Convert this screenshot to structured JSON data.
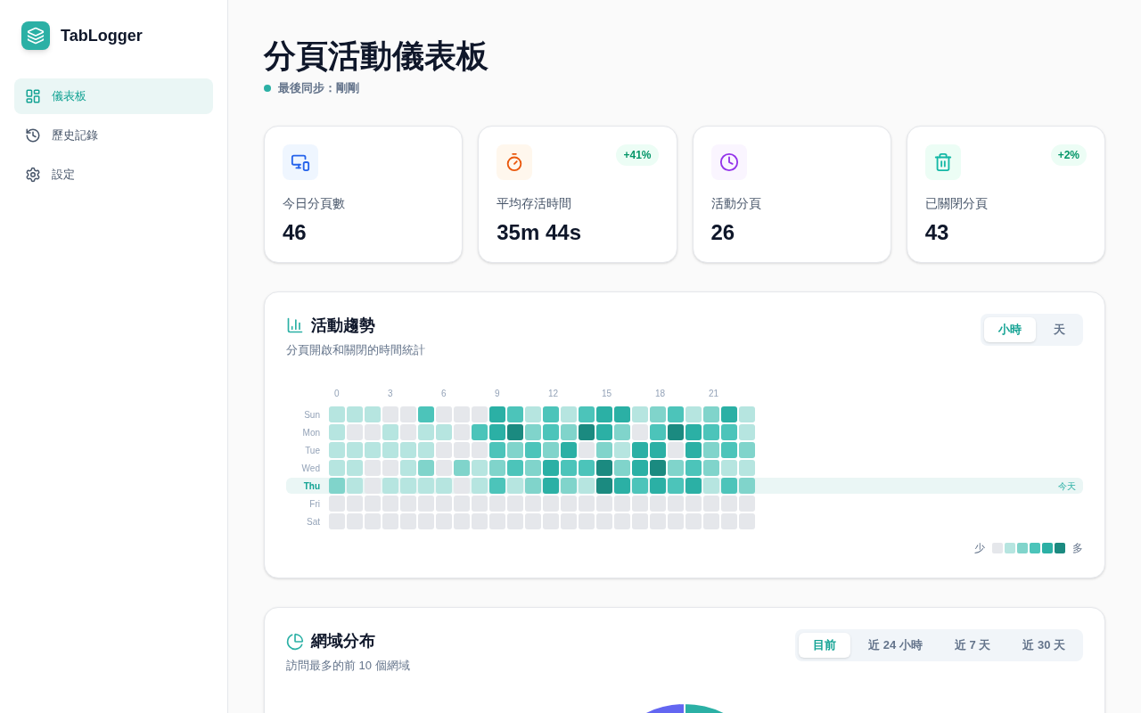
{
  "app": {
    "name": "TabLogger"
  },
  "sidebar": {
    "items": [
      {
        "kind": "dashboard",
        "label": "儀表板",
        "selected": true
      },
      {
        "kind": "history",
        "label": "歷史記錄",
        "selected": false
      },
      {
        "kind": "settings",
        "label": "設定",
        "selected": false
      }
    ]
  },
  "header": {
    "title": "分頁活動儀表板",
    "sync_label": "最後同步：",
    "sync_value": "剛剛"
  },
  "stats": [
    {
      "kind": "tabs",
      "label": "今日分頁數",
      "value": "46"
    },
    {
      "kind": "lifetime",
      "label": "平均存活時間",
      "value": "35m 44s",
      "badge": "+41%"
    },
    {
      "kind": "active",
      "label": "活動分頁",
      "value": "26"
    },
    {
      "kind": "closed",
      "label": "已關閉分頁",
      "value": "43",
      "badge": "+2%"
    }
  ],
  "activity": {
    "title": "活動趨勢",
    "subtitle": "分頁開啟和關閉的時間統計",
    "toggle": [
      {
        "label": "小時",
        "selected": true
      },
      {
        "label": "天",
        "selected": false
      }
    ],
    "hours": [
      {
        "label": "0"
      },
      {
        "label": "3"
      },
      {
        "label": "6"
      },
      {
        "label": "9"
      },
      {
        "label": "12"
      },
      {
        "label": "15"
      },
      {
        "label": "18"
      },
      {
        "label": "21"
      }
    ],
    "rows": [
      {
        "day": "Sun",
        "today": false,
        "cells": [
          {
            "color": "#b6e5e0"
          },
          {
            "color": "#b6e5e0"
          },
          {
            "color": "#b6e5e0"
          },
          {
            "color": "#e5e7eb"
          },
          {
            "color": "#e5e7eb"
          },
          {
            "color": "#4cc4ba"
          },
          {
            "color": "#e5e7eb"
          },
          {
            "color": "#e5e7eb"
          },
          {
            "color": "#e5e7eb"
          },
          {
            "color": "#2bb0a5"
          },
          {
            "color": "#4cc4ba"
          },
          {
            "color": "#b6e5e0"
          },
          {
            "color": "#4cc4ba"
          },
          {
            "color": "#b6e5e0"
          },
          {
            "color": "#4cc4ba"
          },
          {
            "color": "#2bb0a5"
          },
          {
            "color": "#2bb0a5"
          },
          {
            "color": "#b6e5e0"
          },
          {
            "color": "#80d4cb"
          },
          {
            "color": "#4cc4ba"
          },
          {
            "color": "#b6e5e0"
          },
          {
            "color": "#80d4cb"
          },
          {
            "color": "#2bb0a5"
          },
          {
            "color": "#b6e5e0"
          }
        ]
      },
      {
        "day": "Mon",
        "today": false,
        "cells": [
          {
            "color": "#b6e5e0"
          },
          {
            "color": "#e5e7eb"
          },
          {
            "color": "#e5e7eb"
          },
          {
            "color": "#b6e5e0"
          },
          {
            "color": "#e5e7eb"
          },
          {
            "color": "#b6e5e0"
          },
          {
            "color": "#b6e5e0"
          },
          {
            "color": "#e5e7eb"
          },
          {
            "color": "#4cc4ba"
          },
          {
            "color": "#2bb0a5"
          },
          {
            "color": "#1b8a80"
          },
          {
            "color": "#80d4cb"
          },
          {
            "color": "#4cc4ba"
          },
          {
            "color": "#80d4cb"
          },
          {
            "color": "#1b8a80"
          },
          {
            "color": "#2bb0a5"
          },
          {
            "color": "#80d4cb"
          },
          {
            "color": "#e5e7eb"
          },
          {
            "color": "#4cc4ba"
          },
          {
            "color": "#1b8a80"
          },
          {
            "color": "#2bb0a5"
          },
          {
            "color": "#4cc4ba"
          },
          {
            "color": "#4cc4ba"
          },
          {
            "color": "#b6e5e0"
          }
        ]
      },
      {
        "day": "Tue",
        "today": false,
        "cells": [
          {
            "color": "#b6e5e0"
          },
          {
            "color": "#b6e5e0"
          },
          {
            "color": "#b6e5e0"
          },
          {
            "color": "#b6e5e0"
          },
          {
            "color": "#b6e5e0"
          },
          {
            "color": "#b6e5e0"
          },
          {
            "color": "#e5e7eb"
          },
          {
            "color": "#e5e7eb"
          },
          {
            "color": "#e5e7eb"
          },
          {
            "color": "#4cc4ba"
          },
          {
            "color": "#80d4cb"
          },
          {
            "color": "#4cc4ba"
          },
          {
            "color": "#80d4cb"
          },
          {
            "color": "#2bb0a5"
          },
          {
            "color": "#e5e7eb"
          },
          {
            "color": "#80d4cb"
          },
          {
            "color": "#b6e5e0"
          },
          {
            "color": "#2bb0a5"
          },
          {
            "color": "#2bb0a5"
          },
          {
            "color": "#e5e7eb"
          },
          {
            "color": "#2bb0a5"
          },
          {
            "color": "#80d4cb"
          },
          {
            "color": "#4cc4ba"
          },
          {
            "color": "#80d4cb"
          }
        ]
      },
      {
        "day": "Wed",
        "today": false,
        "cells": [
          {
            "color": "#b6e5e0"
          },
          {
            "color": "#b6e5e0"
          },
          {
            "color": "#e5e7eb"
          },
          {
            "color": "#e5e7eb"
          },
          {
            "color": "#b6e5e0"
          },
          {
            "color": "#80d4cb"
          },
          {
            "color": "#e5e7eb"
          },
          {
            "color": "#80d4cb"
          },
          {
            "color": "#b6e5e0"
          },
          {
            "color": "#80d4cb"
          },
          {
            "color": "#4cc4ba"
          },
          {
            "color": "#80d4cb"
          },
          {
            "color": "#2bb0a5"
          },
          {
            "color": "#4cc4ba"
          },
          {
            "color": "#4cc4ba"
          },
          {
            "color": "#1b8a80"
          },
          {
            "color": "#80d4cb"
          },
          {
            "color": "#2bb0a5"
          },
          {
            "color": "#1b8a80"
          },
          {
            "color": "#80d4cb"
          },
          {
            "color": "#4cc4ba"
          },
          {
            "color": "#80d4cb"
          },
          {
            "color": "#b6e5e0"
          },
          {
            "color": "#b6e5e0"
          }
        ]
      },
      {
        "day": "Thu",
        "today": true,
        "today_label": "今天",
        "cells": [
          {
            "color": "#80d4cb"
          },
          {
            "color": "#b6e5e0"
          },
          {
            "color": "#e5e7eb"
          },
          {
            "color": "#b6e5e0"
          },
          {
            "color": "#b6e5e0"
          },
          {
            "color": "#b6e5e0"
          },
          {
            "color": "#b6e5e0"
          },
          {
            "color": "#e5e7eb"
          },
          {
            "color": "#b6e5e0"
          },
          {
            "color": "#4cc4ba"
          },
          {
            "color": "#b6e5e0"
          },
          {
            "color": "#80d4cb"
          },
          {
            "color": "#2bb0a5"
          },
          {
            "color": "#80d4cb"
          },
          {
            "color": "#b6e5e0"
          },
          {
            "color": "#1b8a80"
          },
          {
            "color": "#2bb0a5"
          },
          {
            "color": "#4cc4ba"
          },
          {
            "color": "#2bb0a5"
          },
          {
            "color": "#4cc4ba"
          },
          {
            "color": "#2bb0a5"
          },
          {
            "color": "#b6e5e0"
          },
          {
            "color": "#4cc4ba"
          },
          {
            "color": "#80d4cb"
          }
        ]
      },
      {
        "day": "Fri",
        "today": false,
        "cells": [
          {
            "color": "#e5e7eb"
          },
          {
            "color": "#e5e7eb"
          },
          {
            "color": "#e5e7eb"
          },
          {
            "color": "#e5e7eb"
          },
          {
            "color": "#e5e7eb"
          },
          {
            "color": "#e5e7eb"
          },
          {
            "color": "#e5e7eb"
          },
          {
            "color": "#e5e7eb"
          },
          {
            "color": "#e5e7eb"
          },
          {
            "color": "#e5e7eb"
          },
          {
            "color": "#e5e7eb"
          },
          {
            "color": "#e5e7eb"
          },
          {
            "color": "#e5e7eb"
          },
          {
            "color": "#e5e7eb"
          },
          {
            "color": "#e5e7eb"
          },
          {
            "color": "#e5e7eb"
          },
          {
            "color": "#e5e7eb"
          },
          {
            "color": "#e5e7eb"
          },
          {
            "color": "#e5e7eb"
          },
          {
            "color": "#e5e7eb"
          },
          {
            "color": "#e5e7eb"
          },
          {
            "color": "#e5e7eb"
          },
          {
            "color": "#e5e7eb"
          },
          {
            "color": "#e5e7eb"
          }
        ]
      },
      {
        "day": "Sat",
        "today": false,
        "cells": [
          {
            "color": "#e5e7eb"
          },
          {
            "color": "#e5e7eb"
          },
          {
            "color": "#e5e7eb"
          },
          {
            "color": "#e5e7eb"
          },
          {
            "color": "#e5e7eb"
          },
          {
            "color": "#e5e7eb"
          },
          {
            "color": "#e5e7eb"
          },
          {
            "color": "#e5e7eb"
          },
          {
            "color": "#e5e7eb"
          },
          {
            "color": "#e5e7eb"
          },
          {
            "color": "#e5e7eb"
          },
          {
            "color": "#e5e7eb"
          },
          {
            "color": "#e5e7eb"
          },
          {
            "color": "#e5e7eb"
          },
          {
            "color": "#e5e7eb"
          },
          {
            "color": "#e5e7eb"
          },
          {
            "color": "#e5e7eb"
          },
          {
            "color": "#e5e7eb"
          },
          {
            "color": "#e5e7eb"
          },
          {
            "color": "#e5e7eb"
          },
          {
            "color": "#e5e7eb"
          },
          {
            "color": "#e5e7eb"
          },
          {
            "color": "#e5e7eb"
          },
          {
            "color": "#e5e7eb"
          }
        ]
      }
    ],
    "legend": {
      "low": "少",
      "high": "多"
    }
  },
  "domains": {
    "title": "網域分布",
    "subtitle": "訪問最多的前 10 個網域",
    "toggle": [
      {
        "label": "目前",
        "selected": true
      },
      {
        "label": "近 24 小時",
        "selected": false
      },
      {
        "label": "近 7 天",
        "selected": false
      },
      {
        "label": "近 30 天",
        "selected": false
      }
    ]
  }
}
